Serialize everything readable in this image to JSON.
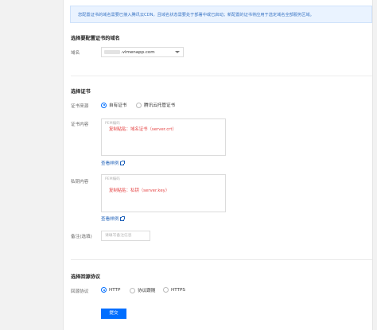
{
  "notice": "您配置证书的域名需要已接入腾讯云CDN，且域名状态需要处于部署中或已启动；新配置的证书将应用于选定域名全部服务区域。",
  "domain_section": {
    "title": "选择要配置证书的域名",
    "label": "域名",
    "value_suffix": ".vimenapp.com"
  },
  "cert_section": {
    "title": "选择证书",
    "source_label": "证书来源",
    "source_options": [
      {
        "label": "自有证书",
        "checked": true
      },
      {
        "label": "腾讯云托管证书",
        "checked": false
      }
    ],
    "content_label": "证书内容",
    "content_placeholder": "PEM编码",
    "content_note": "复制粘贴：域名证书（server.crt）",
    "sample_link": "查看样例",
    "key_label": "私钥内容",
    "key_placeholder": "PEM编码",
    "key_note": "复制粘贴：私钥（server.key）",
    "key_sample_link": "查看样例",
    "remark_label": "备注(选填)",
    "remark_placeholder": "请填写备注信息"
  },
  "origin_section": {
    "title": "选择回源协议",
    "label": "回源协议",
    "options": [
      {
        "label": "HTTP",
        "checked": true
      },
      {
        "label": "协议跟随",
        "checked": false
      },
      {
        "label": "HTTPS",
        "checked": false
      }
    ]
  },
  "submit_label": "提交",
  "colors": {
    "accent": "#006eff",
    "link": "#1c5fb8",
    "note_red": "#e54545",
    "notice_bg": "#eaf3ff"
  }
}
